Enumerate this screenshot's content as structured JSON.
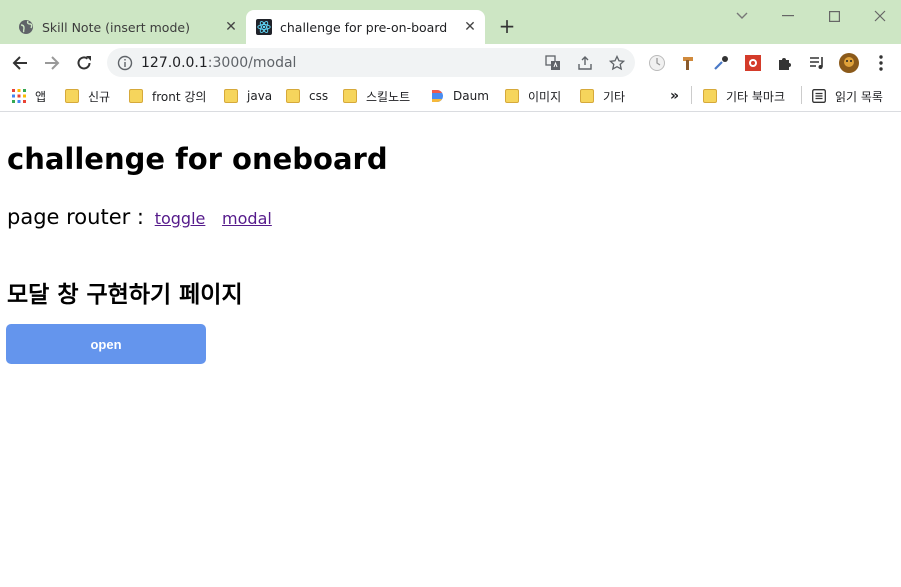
{
  "browser": {
    "tabs": [
      {
        "title": "Skill Note (insert mode)",
        "active": false
      },
      {
        "title": "challenge for pre-on-board",
        "active": true
      }
    ],
    "url_host": "127.0.0.1",
    "url_path": ":3000/modal",
    "bookmarks": [
      "앱",
      "신규",
      "front 강의",
      "java",
      "css",
      "스킬노트",
      "Daum",
      "이미지",
      "기타"
    ],
    "bookmarks_overflow": "»",
    "other_bookmarks": "기타 북마크",
    "reading_list": "읽기 목록",
    "colors": {
      "tab_strip": "#cde6c4",
      "accent_button": "#6495ed",
      "link_visited": "#551a8b"
    }
  },
  "page": {
    "title": "challenge for oneboard",
    "router_label": "page router :",
    "links": [
      "toggle",
      "modal"
    ],
    "section_title": "모달 창 구현하기 페이지",
    "open_button": "open"
  }
}
